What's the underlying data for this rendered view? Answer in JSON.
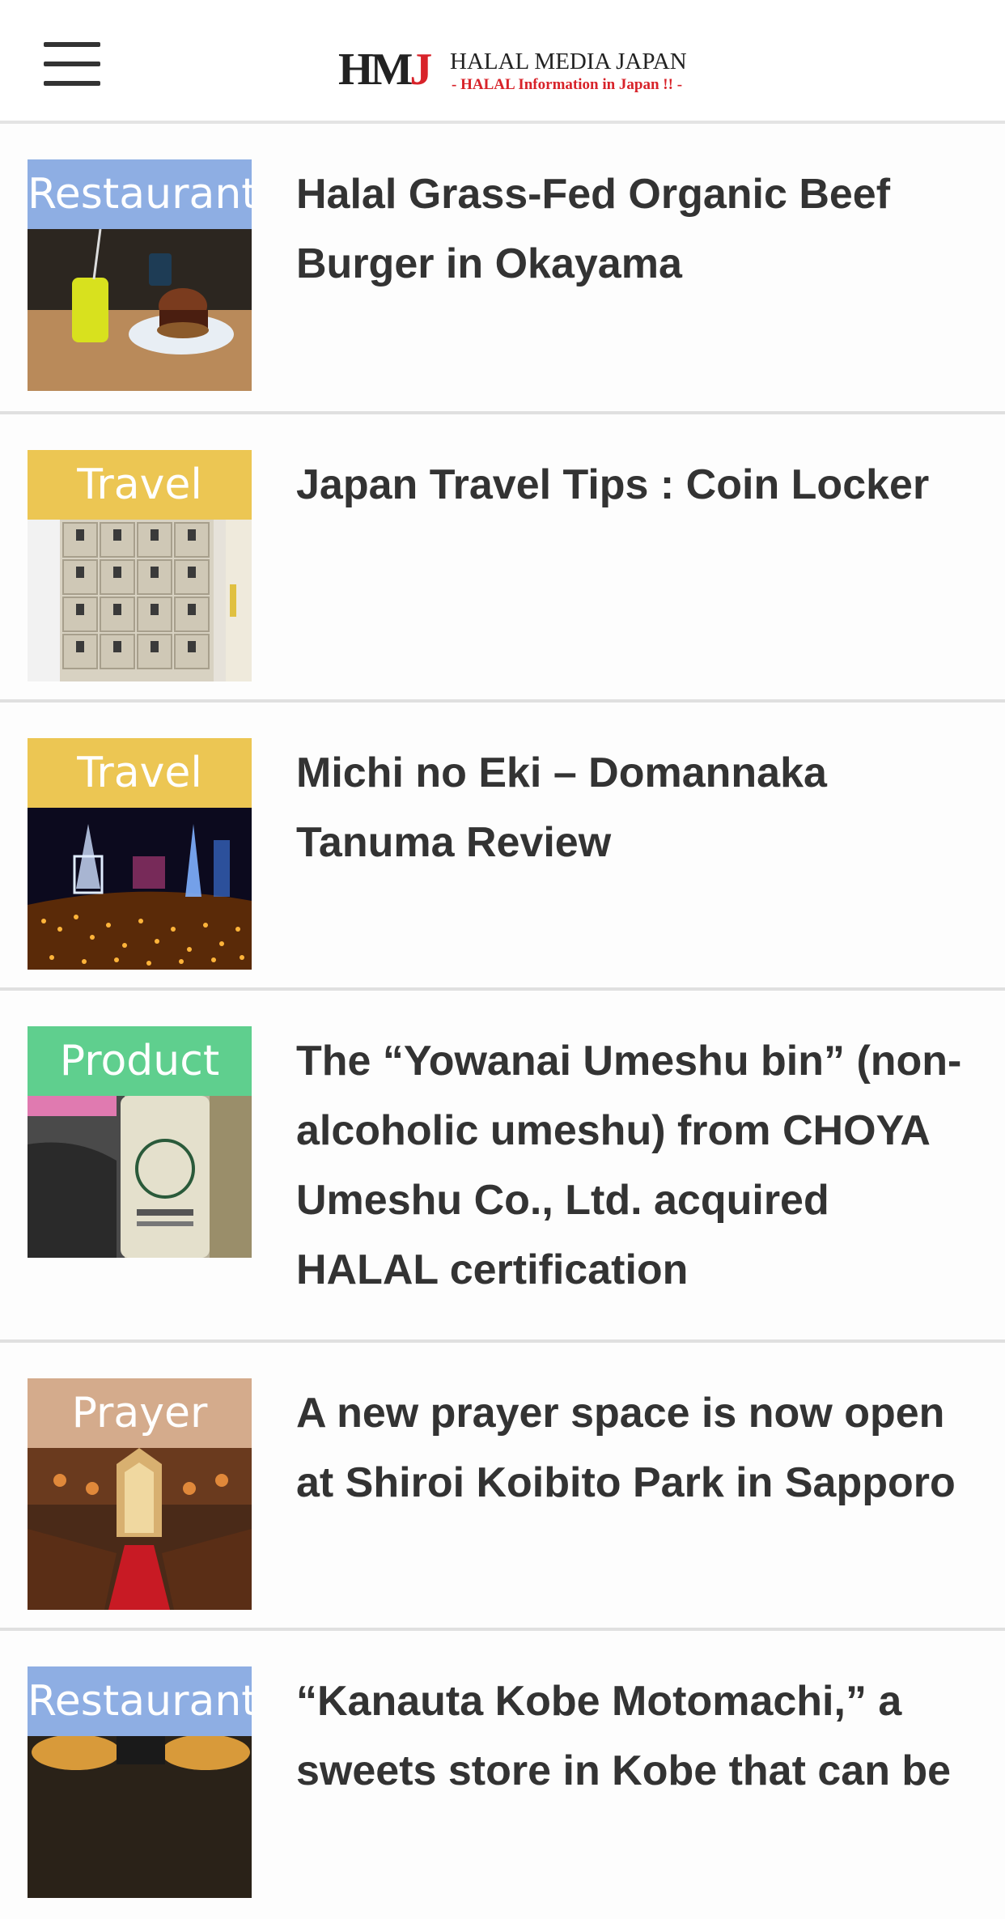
{
  "header": {
    "menu_icon": "hamburger-menu-icon",
    "logo_mark": "HM",
    "logo_mark_j": "J",
    "logo_title": "HALAL MEDIA JAPAN",
    "logo_subtitle": "- HALAL Information in Japan !! -"
  },
  "colors": {
    "restaurant": "#8eaee3",
    "travel": "#ecc653",
    "product": "#5fcf8e",
    "prayer": "#d4ab8c",
    "logo_red": "#d8232a",
    "text": "#333333"
  },
  "articles": [
    {
      "category": "Restaurant",
      "title": "Halal Grass-Fed Organic Beef Burger in Okayama"
    },
    {
      "category": "Travel",
      "title": "Japan Travel Tips : Coin Locker"
    },
    {
      "category": "Travel",
      "title": "Michi no Eki – Domannaka Tanuma Review"
    },
    {
      "category": "Product",
      "title": "The “Yowanai Umeshu bin” (non-alcoholic umeshu) from CHOYA Umeshu Co., Ltd. acquired HALAL certification"
    },
    {
      "category": "Prayer",
      "title": "A new prayer space is now open at Shiroi Koibito Park in Sapporo"
    },
    {
      "category": "Restaurant",
      "title": "“Kanauta Kobe Motomachi,” a sweets store in Kobe that can be"
    }
  ]
}
